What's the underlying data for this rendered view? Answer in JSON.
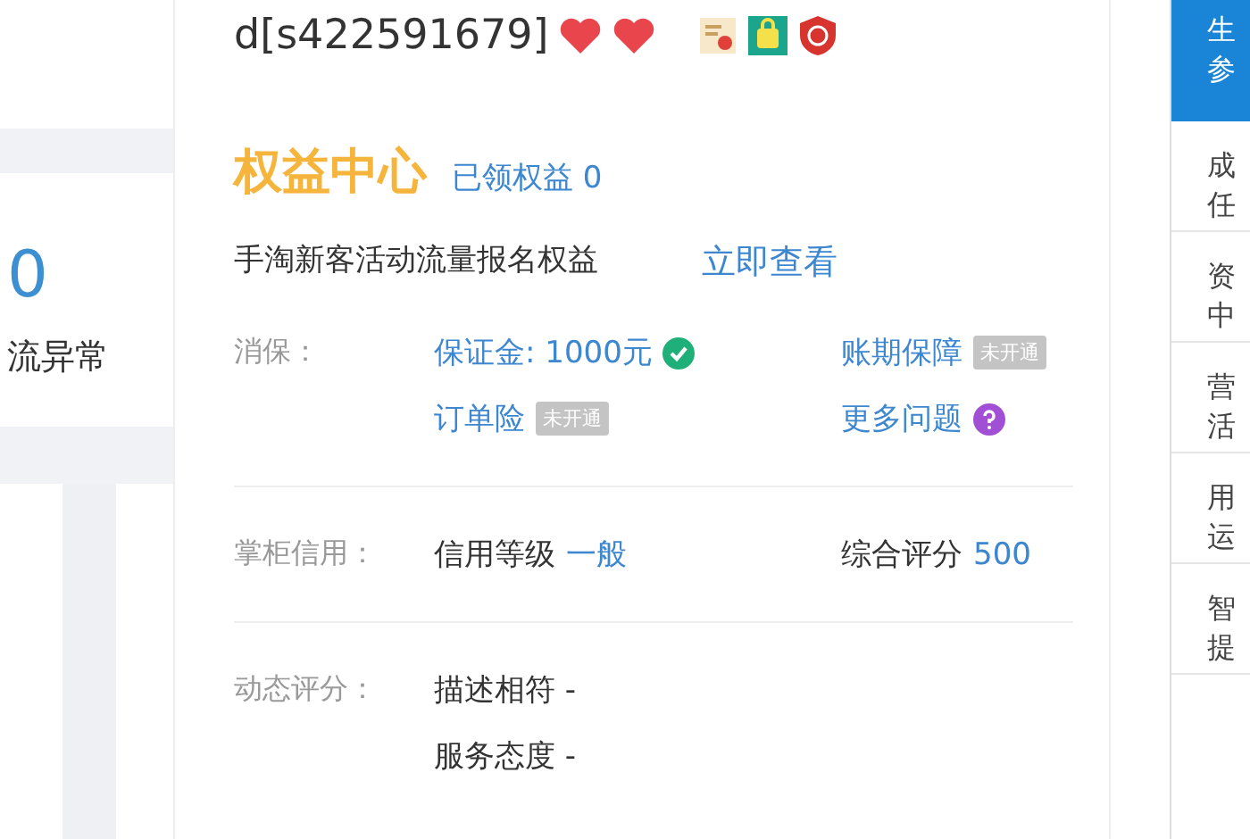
{
  "left_panel": {
    "count": "0",
    "caption": "流异常"
  },
  "shop": {
    "name": "d[s422591679]"
  },
  "benefits": {
    "title": "权益中心",
    "claimed": "已领权益 0",
    "promo": "手淘新客活动流量报名权益",
    "promo_link": "立即查看"
  },
  "consumer_protection": {
    "label": "消保：",
    "items": [
      {
        "text": "保证金: 1000元",
        "kind": "check"
      },
      {
        "text": "账期保障",
        "kind": "tag",
        "badge": "未开通"
      },
      {
        "text": "订单险",
        "kind": "tag",
        "badge": "未开通"
      },
      {
        "text": "更多问题",
        "kind": "help"
      }
    ]
  },
  "credit": {
    "label": "掌柜信用：",
    "level_label": "信用等级",
    "level_value": "一般",
    "score_label": "综合评分",
    "score_value": "500"
  },
  "dynamic_rating": {
    "label": "动态评分：",
    "rows": [
      "描述相符 -",
      "服务态度 -"
    ]
  },
  "side_menu": [
    {
      "lines": [
        "生",
        "参"
      ],
      "selected": true
    },
    {
      "lines": [
        "成",
        "任"
      ],
      "selected": false
    },
    {
      "lines": [
        "资",
        "中"
      ],
      "selected": false
    },
    {
      "lines": [
        "营",
        "活"
      ],
      "selected": false
    },
    {
      "lines": [
        "用",
        "运"
      ],
      "selected": false
    },
    {
      "lines": [
        "智",
        "提"
      ],
      "selected": false
    }
  ]
}
